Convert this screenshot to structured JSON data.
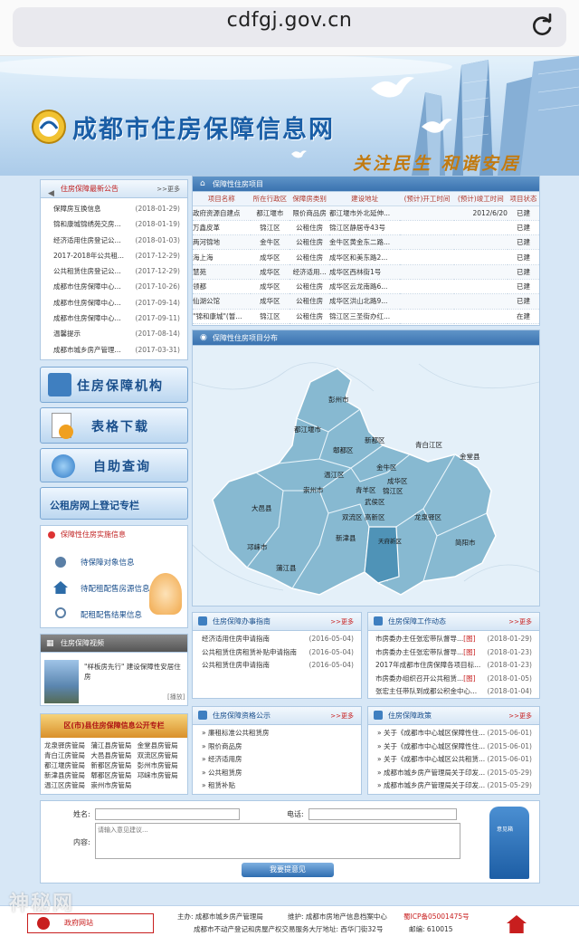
{
  "browser": {
    "url": "cdfgj.gov.cn"
  },
  "header": {
    "site_name": "成都市住房保障信息网",
    "slogan": "关注民生 和谐安居"
  },
  "announcements": {
    "title": "住房保障最新公告",
    "more": ">>更多",
    "items": [
      {
        "title": "保障房互换信息",
        "date": "(2018-01-29)"
      },
      {
        "title": "锦和康城锦绣苑交房...",
        "date": "(2018-01-19)"
      },
      {
        "title": "经济适用住房登记公...",
        "date": "(2018-01-03)"
      },
      {
        "title": "2017-2018年公共租...",
        "date": "(2017-12-29)"
      },
      {
        "title": "公共租赁住房登记公...",
        "date": "(2017-12-29)"
      },
      {
        "title": "成都市住房保障中心...",
        "date": "(2017-10-26)"
      },
      {
        "title": "成都市住房保障中心...",
        "date": "(2017-09-14)"
      },
      {
        "title": "成都市住房保障中心...",
        "date": "(2017-09-11)"
      },
      {
        "title": "温馨提示",
        "date": "(2017-08-14)"
      },
      {
        "title": "成都市城乡房产管理...",
        "date": "(2017-03-31)"
      }
    ]
  },
  "projects": {
    "title": "保障性住房项目",
    "columns": [
      "项目名称",
      "所在行政区",
      "保障房类别",
      "建设地址",
      "(预计)开工时间",
      "(预计)竣工时间",
      "项目状态"
    ],
    "rows": [
      [
        "政府资源自建点",
        "都江堰市",
        "限价商品房",
        "都江堰市外北延伸...",
        "",
        "2012/6/20",
        "已建"
      ],
      [
        "万鑫皮革",
        "锦江区",
        "公租住房",
        "锦江区静居寺43号",
        "",
        "",
        "已建"
      ],
      [
        "两河锦地",
        "金牛区",
        "公租住房",
        "金牛区黄金东二路...",
        "",
        "",
        "已建"
      ],
      [
        "海上海",
        "成华区",
        "公租住房",
        "成华区和美东路2...",
        "",
        "",
        "已建"
      ],
      [
        "慧苑",
        "成华区",
        "经济适用...",
        "成华区西林街1号",
        "",
        "",
        "已建"
      ],
      [
        "领都",
        "成华区",
        "公租住房",
        "成华区云龙南路6...",
        "",
        "",
        "已建"
      ],
      [
        "仙湖公馆",
        "成华区",
        "公租住房",
        "成华区洪山北路9...",
        "",
        "",
        "已建"
      ],
      [
        "\"锦和康城\"(暂...",
        "锦江区",
        "公租住房",
        "锦江区三圣街办红...",
        "",
        "",
        "在建"
      ]
    ]
  },
  "map": {
    "title": "保障性住房项目分布",
    "districts": [
      "彭州市",
      "都江堰市",
      "郫都区",
      "新都区",
      "青白江区",
      "金堂县",
      "金牛区",
      "成华区",
      "温江区",
      "崇州市",
      "青羊区",
      "锦江区",
      "武侯区",
      "大邑县",
      "双流区",
      "高新区",
      "龙泉驿区",
      "天府新区",
      "简阳市",
      "新津县",
      "邛崃市",
      "蒲江县"
    ]
  },
  "sidebar": {
    "org": "住房保障机构",
    "forms": "表格下载",
    "selfquery": "自助查询",
    "register": "公租房网上登记专栏",
    "impl_title": "保障性住房实施信息",
    "impl_items": [
      "待保障对象信息",
      "待配租配售房源信息",
      "配租配售结果信息"
    ],
    "video_title": "住房保障视频",
    "video_caption": "\"样板房先行\" 建设保障性安居住房",
    "video_label": "[播放]",
    "bureaus_title": "区(市)县住房保障信息公开专栏",
    "bureaus": [
      "龙泉驿房管局",
      "蒲江县房管局",
      "金堂县房管局",
      "青白江房管局",
      "大邑县房管局",
      "双流区房管局",
      "都江堰房管局",
      "新都区房管局",
      "彭州市房管局",
      "新津县房管局",
      "郫都区房管局",
      "邛崃市房管局",
      "温江区房管局",
      "崇州市房管局"
    ]
  },
  "guide": {
    "title": "住房保障办事指南",
    "more": ">>更多",
    "items": [
      {
        "title": "经济适用住房申请指南",
        "date": "(2016-05-04)"
      },
      {
        "title": "公共租赁住房租赁补贴申请指南",
        "date": "(2016-05-04)"
      },
      {
        "title": "公共租赁住房申请指南",
        "date": "(2016-05-04)"
      }
    ]
  },
  "news": {
    "title": "住房保障工作动态",
    "more": ">>更多",
    "items": [
      {
        "title": "市房委办主任张宏带队督导...",
        "tag": "[图]",
        "date": "(2018-01-29)"
      },
      {
        "title": "市房委办主任张宏带队督导...",
        "tag": "[图]",
        "date": "(2018-01-23)"
      },
      {
        "title": "2017年成都市住房保障各项目标...",
        "tag": "",
        "date": "(2018-01-23)"
      },
      {
        "title": "市房委办组织召开公共租赁...",
        "tag": "[图]",
        "date": "(2018-01-05)"
      },
      {
        "title": "张宏主任带队到成都公积金中心...",
        "tag": "",
        "date": "(2018-01-04)"
      }
    ]
  },
  "eligibility": {
    "title": "住房保障资格公示",
    "more": ">>更多",
    "items": [
      "廉租标准公共租赁房",
      "限价商品房",
      "经济适用房",
      "公共租赁房",
      "租赁补贴"
    ]
  },
  "policy": {
    "title": "住房保障政策",
    "more": ">>更多",
    "items": [
      {
        "title": "关于《成都市中心城区保障性住...",
        "date": "(2015-06-01)"
      },
      {
        "title": "关于《成都市中心城区保障性住...",
        "date": "(2015-06-01)"
      },
      {
        "title": "关于《成都市中心城区公共租赁...",
        "date": "(2015-06-01)"
      },
      {
        "title": "成都市城乡房产管理局关于印发...",
        "date": "(2015-05-29)"
      },
      {
        "title": "成都市城乡房产管理局关于印发...",
        "date": "(2015-05-29)"
      }
    ]
  },
  "feedback": {
    "name_label": "姓名:",
    "phone_label": "电话:",
    "content_label": "内容:",
    "content_placeholder": "请输入意见建议...",
    "submit": "我要提意见",
    "mailbox": "意见箱"
  },
  "footer": {
    "line1a": "主办: 成都市城乡房产管理局",
    "line1b": "维护: 成都市房地产信息档案中心",
    "icp": "蜀ICP备05001475号",
    "line2": "成都市不动产登记和房屋产权交易服务大厅地址: 西华门街32号",
    "zip": "邮编: 610015",
    "gov_badge": "政府网站"
  },
  "watermark": "神秘网"
}
